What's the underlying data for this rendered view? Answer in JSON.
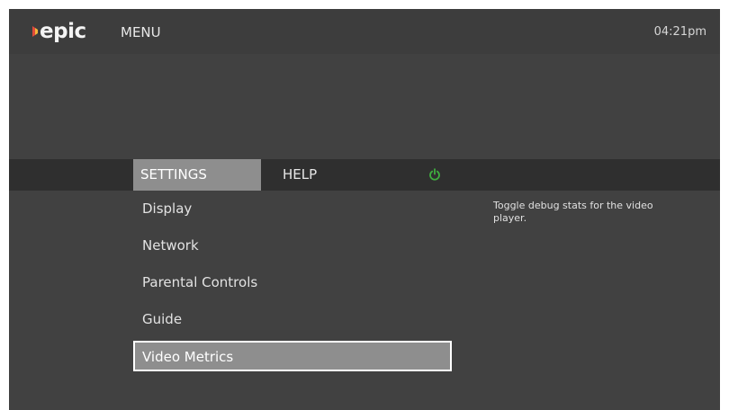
{
  "header": {
    "logo_text": "epic",
    "menu_title": "MENU",
    "clock": "04:21pm"
  },
  "tabs": [
    {
      "label": "SETTINGS",
      "selected": true
    },
    {
      "label": "HELP",
      "selected": false
    }
  ],
  "icons": {
    "logo": "epic-logo-icon",
    "power": "power-icon"
  },
  "colors": {
    "background": "#414141",
    "tab_bar": "#2f2f2f",
    "selected_fill": "#8e8e8e",
    "power_green": "#3fae3f",
    "logo_red": "#e14b3b",
    "logo_yellow": "#f4b63a"
  },
  "settings_menu": {
    "items": [
      {
        "label": "Display"
      },
      {
        "label": "Network"
      },
      {
        "label": "Parental Controls"
      },
      {
        "label": "Guide"
      },
      {
        "label": "Video Metrics",
        "selected": true
      }
    ]
  },
  "description": "Toggle debug stats for the video player."
}
